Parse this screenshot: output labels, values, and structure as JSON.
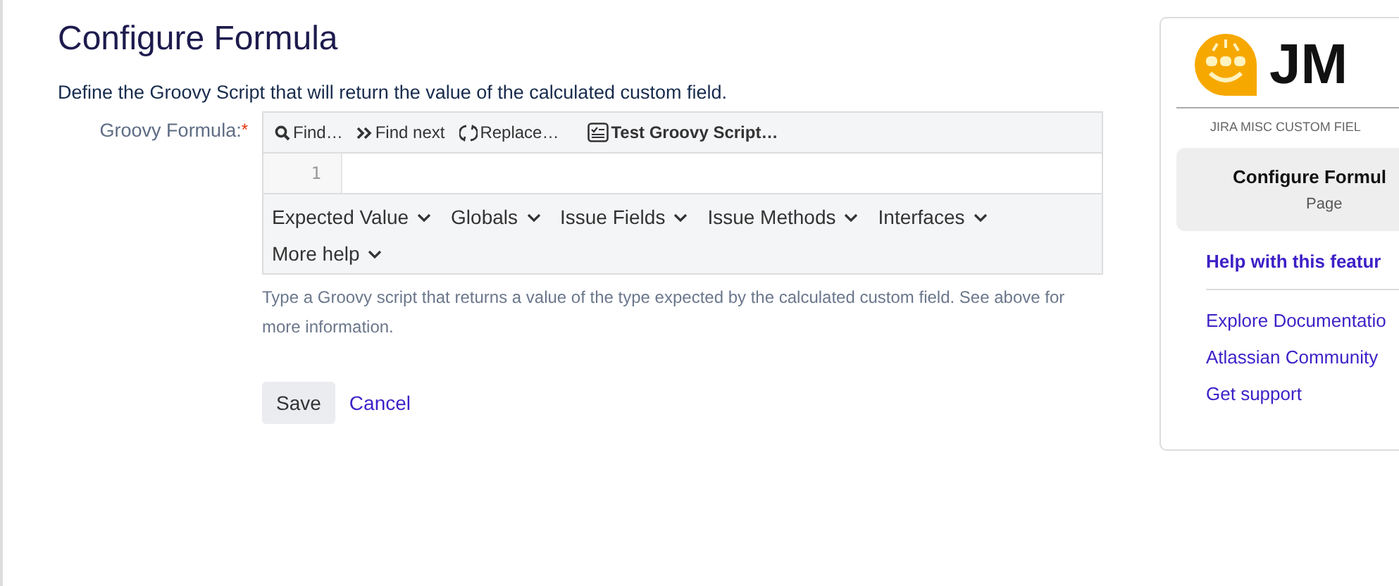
{
  "title": "Configure Formula",
  "description": "Define the Groovy Script that will return the value of the calculated custom field.",
  "field": {
    "label": "Groovy Formula:",
    "required_mark": "*"
  },
  "toolbar": [
    {
      "kind": "search",
      "label": "Find…"
    },
    {
      "kind": "next",
      "label": "Find next"
    },
    {
      "kind": "replace",
      "label": "Replace…"
    },
    {
      "kind": "test",
      "label": "Test Groovy Script…"
    }
  ],
  "editor": {
    "line_numbers": [
      "1"
    ]
  },
  "help_menus": [
    "Expected Value",
    "Globals",
    "Issue Fields",
    "Issue Methods",
    "Interfaces",
    "More help"
  ],
  "hint": "Type a Groovy script that returns a value of the type expected by the calculated custom field. See above for more information.",
  "buttons": {
    "save": "Save",
    "cancel": "Cancel"
  },
  "sidebar": {
    "logo_text": "JM",
    "subtitle": "JIRA MISC CUSTOM FIEL",
    "current": {
      "title": "Configure Formul",
      "subtitle": "Page"
    },
    "help_title": "Help with this featur",
    "links": [
      "Explore Documentatio",
      "Atlassian Community",
      "Get support"
    ]
  }
}
